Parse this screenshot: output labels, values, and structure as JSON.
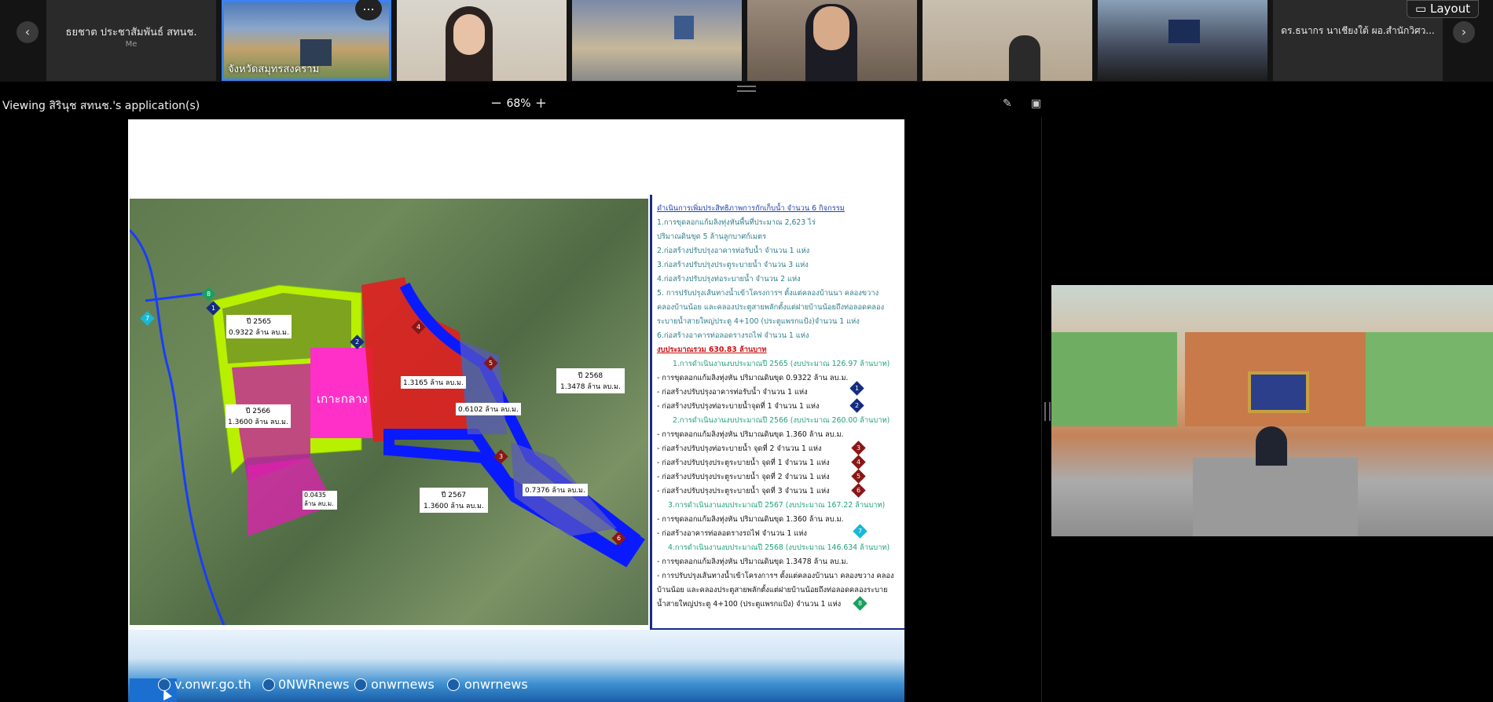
{
  "strip": {
    "prev_icon": "chevron-left-icon",
    "next_icon": "chevron-right-icon",
    "me_tile": {
      "name": "ธยชาต ประชาสัมพันธ์ สทนช.",
      "sub": "Me"
    },
    "active_tile_label": "จังหวัดสมุทรสงคราม",
    "more_label": "...",
    "last_tile_name": "ดร.ธนากร นาเชียงใต้ ผอ.สำนักวิศว...",
    "layout_label": "Layout"
  },
  "viewbar": {
    "title": "Viewing สิรินุช สทนช.'s application(s)",
    "zoom_value": "68%",
    "zoom_minus": "−",
    "zoom_plus": "+"
  },
  "map_labels": {
    "center": "เกาะกลาง",
    "p2565": "ปี 2565",
    "p2565_v": "0.9322 ล้าน ลบ.ม.",
    "p2566": "ปี 2566",
    "p2566_v": "1.3600 ล้าน ลบ.ม.",
    "p2567": "ปี 2567",
    "p2567_v": "1.3600 ล้าน ลบ.ม.",
    "p2568": "ปี 2568",
    "p2568_v": "1.3478 ล้าน ลบ.ม.",
    "v13165": "1.3165 ล้าน ลบ.ม.",
    "v06102": "0.6102 ล้าน ลบ.ม.",
    "v07376": "0.7376 ล้าน ลบ.ม.",
    "v00435": "0.0435 ล้าน ลบ.ม.",
    "markers": [
      "1",
      "2",
      "3",
      "4",
      "5",
      "6",
      "7",
      "8"
    ]
  },
  "panel_lines": [
    "ดำเนินการเพิ่มประสิทธิภาพการกักเก็บน้ำ จำนวน 6 กิจกรรม",
    "1.การขุดลอกแก้มลิงทุ่งหันพื้นที่ประมาณ 2,623 ไร่",
    "ปริมาณดินขุด 5 ล้านลูกบาศก์เมตร",
    "2.ก่อสร้างปรับปรุงอาคารท่อรับน้ำ จำนวน 1 แห่ง",
    "3.ก่อสร้างปรับปรุงประตูระบายน้ำ จำนวน 3 แห่ง",
    "4.ก่อสร้างปรับปรุงท่อระบายน้ำ จำนวน 2 แห่ง",
    "5. การปรับปรุงเส้นทางน้ำเข้าโครงการฯ ตั้งแต่คลองบ้านนา คลองขวาง",
    "คลองบ้านน้อย และคลองประตูสายพลักตั้งแต่ฝายบ้านน้อยถึงท่อลอดคลอง",
    "ระบายน้ำสายใหญ่ประตู 4+100 (ประตูแพรกแป้ง)จำนวน 1 แห่ง",
    "6.ก่อสร้างอาคารท่อลอดรางรถไฟ จำนวน 1 แห่ง",
    "งบประมาณรวม 630.83 ล้านบาท",
    "1.การดำเนินงานงบประมาณปี 2565 (งบประมาณ 126.97 ล้านบาท)",
    "- การขุดลอกแก้มลิงทุ่งหัน ปริมาณดินขุด 0.9322 ล้าน ลบ.ม.",
    "- ก่อสร้างปรับปรุงอาคารท่อรับน้ำ จำนวน 1 แห่ง",
    "- ก่อสร้างปรับปรุงท่อระบายน้ำจุดที่ 1 จำนวน 1 แห่ง",
    "2.การดำเนินงานงบประมาณปี 2566 (งบประมาณ 260.00 ล้านบาท)",
    "- การขุดลอกแก้มลิงทุ่งหัน ปริมาณดินขุด 1.360 ล้าน ลบ.ม.",
    "- ก่อสร้างปรับปรุงท่อระบายน้ำ จุดที่ 2 จำนวน 1 แห่ง",
    "- ก่อสร้างปรับปรุงประตูระบายน้ำ จุดที่ 1 จำนวน 1 แห่ง",
    "- ก่อสร้างปรับปรุงประตูระบายน้ำ จุดที่ 2 จำนวน 1 แห่ง",
    "- ก่อสร้างปรับปรุงประตูระบายน้ำ จุดที่ 3 จำนวน 1 แห่ง",
    "3.การดำเนินงานงบประมาณปี 2567 (งบประมาณ 167.22 ล้านบาท)",
    "- การขุดลอกแก้มลิงทุ่งหัน ปริมาณดินขุด 1.360 ล้าน ลบ.ม.",
    "- ก่อสร้างอาคารท่อลอดรางรถไฟ จำนวน 1 แห่ง",
    "4.การดำเนินงานงบประมาณปี 2568 (งบประมาณ 146.634 ล้านบาท)",
    "- การขุดลอกแก้มลิงทุ่งหัน ปริมาณดินขุด 1.3478 ล้าน ลบ.ม.",
    "- การปรับปรุงเส้นทางน้ำเข้าโครงการฯ ตั้งแต่คลองบ้านนา คลองขวาง คลอง",
    "บ้านน้อย และคลองประตูสายพลักตั้งแต่ฝายบ้านน้อยถึงท่อลอดคลองระบาย",
    "น้ำสายใหญ่ประตู 4+100 (ประตูแพรกแป้ง) จำนวน 1 แห่ง"
  ],
  "footer": {
    "site": "v.onwr.go.th",
    "fb": "0NWRnews",
    "yt": "onwrnews",
    "tw": "onwrnews"
  },
  "colors": {
    "accent": "#3b82f6",
    "panel_border": "#1a2a8a"
  }
}
